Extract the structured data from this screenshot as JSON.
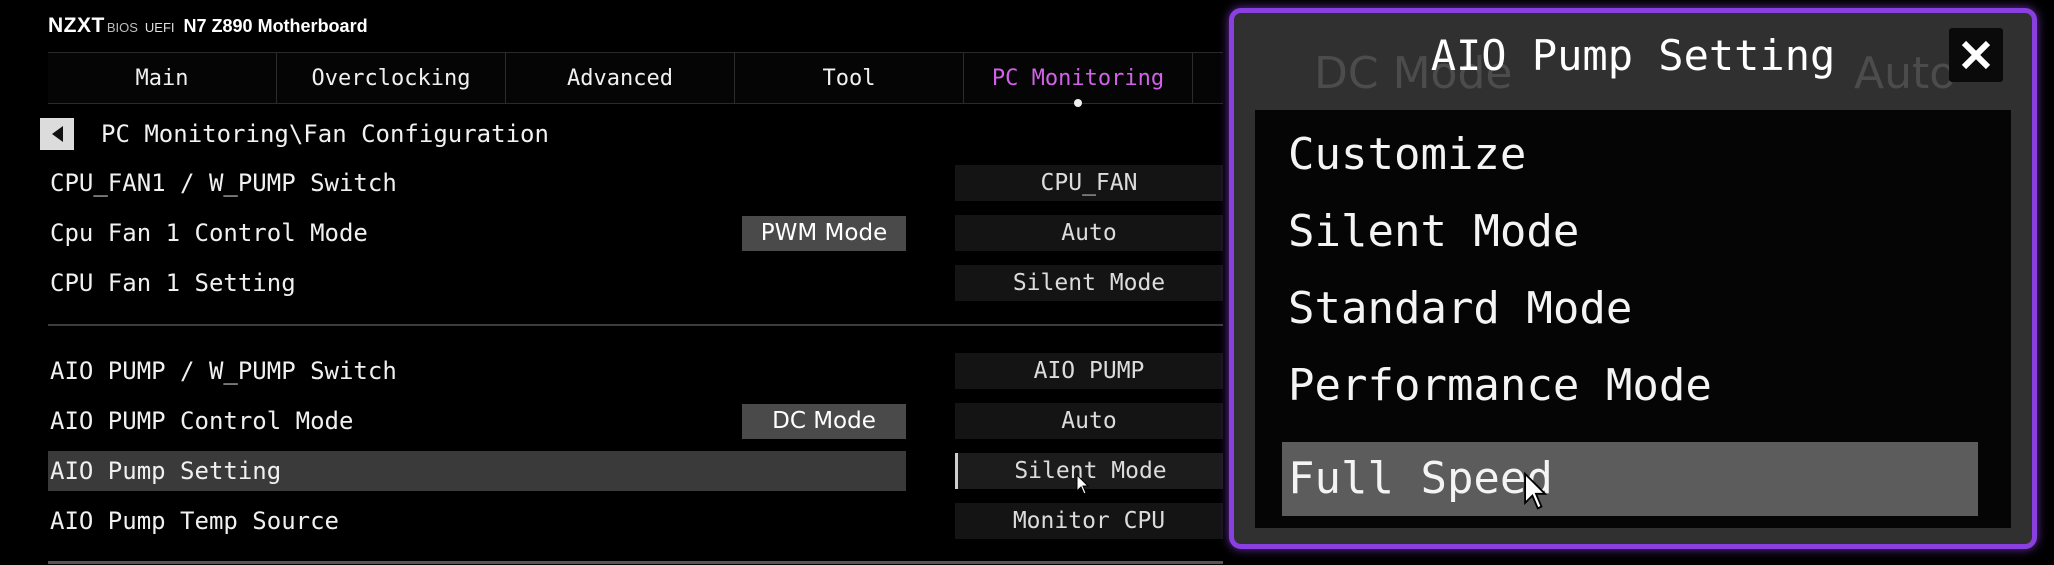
{
  "brand": {
    "logo": "NZXT",
    "bios": "BIOS",
    "uefi": "UEFI",
    "model": "N7 Z890 Motherboard"
  },
  "tabs": [
    {
      "label": "Main"
    },
    {
      "label": "Overclocking"
    },
    {
      "label": "Advanced"
    },
    {
      "label": "Tool"
    },
    {
      "label": "PC Monitoring",
      "active": true
    }
  ],
  "breadcrumb": {
    "path": "PC Monitoring\\Fan Configuration"
  },
  "settings": [
    {
      "label": "CPU_FAN1 / W_PUMP Switch",
      "value": "CPU_FAN"
    },
    {
      "label": "Cpu Fan 1 Control Mode",
      "mode": "PWM Mode",
      "value": "Auto"
    },
    {
      "label": "CPU Fan 1 Setting",
      "value": "Silent Mode"
    },
    {
      "label": "AIO PUMP / W_PUMP Switch",
      "value": "AIO PUMP"
    },
    {
      "label": "AIO PUMP Control Mode",
      "mode": "DC Mode",
      "value": "Auto"
    },
    {
      "label": "AIO Pump Setting",
      "value": "Silent Mode",
      "highlighted": true
    },
    {
      "label": "AIO Pump Temp Source",
      "value": "Monitor CPU"
    }
  ],
  "modal": {
    "title": "AIO Pump Setting",
    "options": [
      "Customize",
      "Silent Mode",
      "Standard Mode",
      "Performance Mode",
      "Full Speed"
    ],
    "selected": "Full Speed",
    "background_ghost": [
      "DC Mode",
      "Auto"
    ]
  },
  "colors": {
    "accent_tab": "#d062e8",
    "modal_border": "#8a3fe0"
  }
}
